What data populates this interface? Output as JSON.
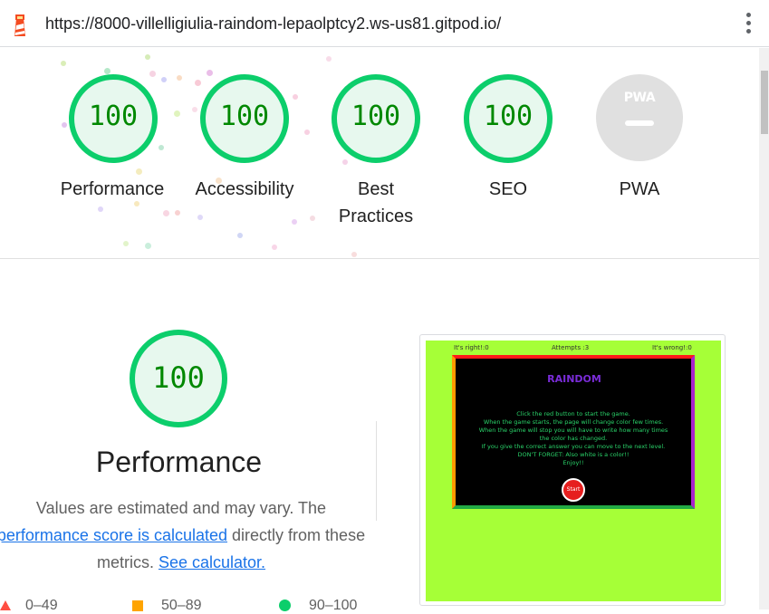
{
  "browser": {
    "url": "https://8000-villelligiulia-raindom-lepaolptcy2.ws-us81.gitpod.io/",
    "site_icon": "lighthouse-icon",
    "menu_icon": "more-vert-icon"
  },
  "summary_gauges": [
    {
      "label": "Performance",
      "score": "100"
    },
    {
      "label": "Accessibility",
      "score": "100"
    },
    {
      "label": "Best Practices",
      "score": "100"
    },
    {
      "label": "SEO",
      "score": "100"
    }
  ],
  "pwa": {
    "badge_text": "PWA",
    "label": "PWA"
  },
  "performance": {
    "score": "100",
    "title": "Performance",
    "desc_prefix": "Values are estimated and may vary. The",
    "link_score": "performance score is calculated",
    "desc_middle": "directly from these metrics.",
    "link_calculator": "See calculator."
  },
  "legend": {
    "fail": "0–49",
    "average": "50–89",
    "pass": "90–100"
  },
  "screenshot": {
    "right_label": "It's right!:",
    "right_value": "0",
    "attempts_label": "Attempts :",
    "attempts_value": "3",
    "wrong_label": "It's wrong!:",
    "wrong_value": "0",
    "logo": "RAINDOM",
    "instructions": [
      "Click the red button to start the game.",
      "When the game starts, the page will change color few times.",
      "When the game will stop you will have to write how many times",
      "the color has changed.",
      "If you give the correct answer you can move to the next level.",
      "DON'T FORGET: Also white is a color!!",
      "Enjoy!!"
    ],
    "start_label": "Start"
  },
  "colors": {
    "pass": "#0cce6b",
    "pass_fill": "#e7f8ee",
    "score_text": "#008800",
    "link": "#1a73e8",
    "game_bg": "#a6ff37"
  }
}
